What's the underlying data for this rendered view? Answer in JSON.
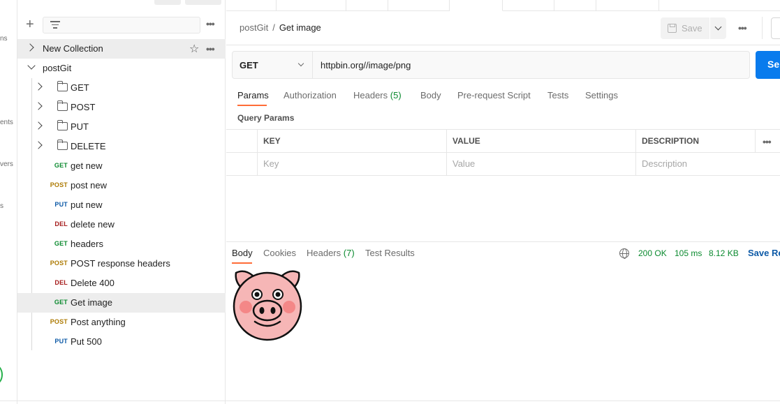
{
  "rail": {
    "labels": [
      "ns",
      "ents",
      "vers",
      "s"
    ]
  },
  "sidebar": {
    "more_glyph": "•••",
    "collections": [
      {
        "label": "New Collection",
        "expanded": false
      },
      {
        "label": "postGit",
        "expanded": true
      }
    ],
    "folders": [
      "GET",
      "POST",
      "PUT",
      "DELETE"
    ],
    "requests": [
      {
        "method": "GET",
        "label": "get new"
      },
      {
        "method": "POST",
        "label": "post new"
      },
      {
        "method": "PUT",
        "label": "put new"
      },
      {
        "method": "DEL",
        "label": "delete new"
      },
      {
        "method": "GET",
        "label": "headers"
      },
      {
        "method": "POST",
        "label": "POST response headers"
      },
      {
        "method": "DEL",
        "label": "Delete 400"
      },
      {
        "method": "GET",
        "label": "Get image",
        "selected": true
      },
      {
        "method": "POST",
        "label": "Post anything"
      },
      {
        "method": "PUT",
        "label": "Put 500"
      }
    ]
  },
  "header": {
    "breadcrumb_parent": "postGit",
    "breadcrumb_sep": "/",
    "breadcrumb_current": "Get image",
    "save_label": "Save",
    "more_glyph": "•••"
  },
  "request": {
    "method": "GET",
    "url": "httpbin.org//image/png",
    "send_label": "Send"
  },
  "request_tabs": {
    "params": "Params",
    "authorization": "Authorization",
    "headers": "Headers",
    "headers_count": "(5)",
    "body": "Body",
    "prerequest": "Pre-request Script",
    "tests": "Tests",
    "settings": "Settings"
  },
  "query_params": {
    "title": "Query Params",
    "columns": [
      "KEY",
      "VALUE",
      "DESCRIPTION"
    ],
    "placeholders": [
      "Key",
      "Value",
      "Description"
    ],
    "more_glyph": "•••"
  },
  "response": {
    "tabs": {
      "body": "Body",
      "cookies": "Cookies",
      "headers": "Headers",
      "headers_count": "(7)",
      "test_results": "Test Results"
    },
    "status": "200 OK",
    "time": "105 ms",
    "size": "8.12 KB",
    "save_label": "Save Response"
  },
  "colors": {
    "accent": "#ff6c37",
    "send": "#097bed",
    "get": "#0b8a2f",
    "post": "#ad7a03",
    "put": "#0d5aa7",
    "delete": "#a61c1c"
  }
}
